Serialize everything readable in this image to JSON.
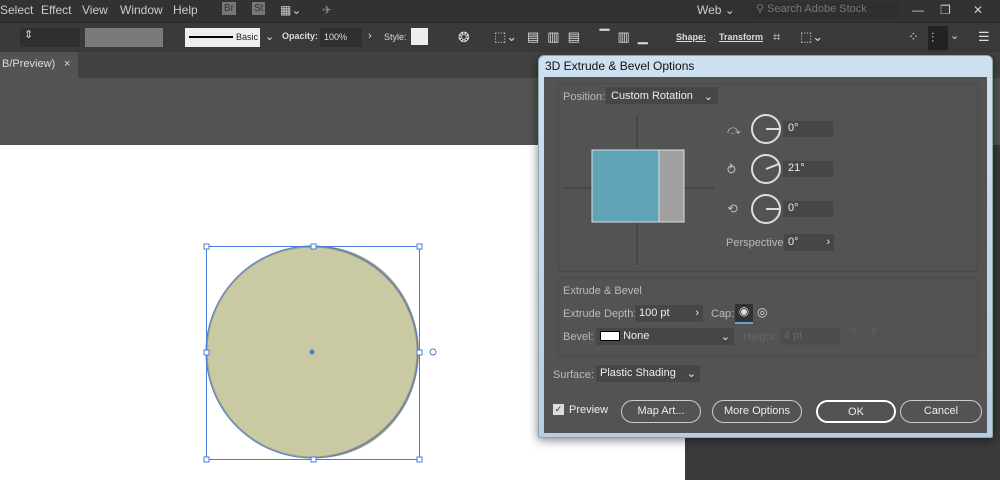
{
  "menu": [
    "Select",
    "Effect",
    "View",
    "Window",
    "Help"
  ],
  "menu_icons": [
    "Br",
    "St"
  ],
  "workspace": "Web",
  "search_placeholder": "Search Adobe Stock",
  "control": {
    "stroke_style": "Basic",
    "opacity_label": "Opacity:",
    "opacity": "100%",
    "style_label": "Style:",
    "shape": "Shape:",
    "transform": "Transform"
  },
  "doc_tab": "B/Preview)",
  "dialog": {
    "title": "3D Extrude & Bevel Options",
    "position_label": "Position:",
    "position": "Custom Rotation",
    "rot_x": "0°",
    "rot_y": "21°",
    "rot_z": "0°",
    "perspective_label": "Perspective:",
    "perspective": "0°",
    "extrude_section": "Extrude & Bevel",
    "depth_label": "Extrude Depth:",
    "depth": "100 pt",
    "cap_label": "Cap:",
    "bevel_label": "Bevel:",
    "bevel": "None",
    "height_label": "Height:",
    "height": "4 pt",
    "surface_label": "Surface:",
    "surface": "Plastic Shading",
    "preview_label": "Preview",
    "preview_checked": true,
    "map_art": "Map Art...",
    "more_options": "More Options",
    "ok": "OK",
    "cancel": "Cancel"
  },
  "colors": {
    "cube_front": "#5ea3b6",
    "cube_side": "#a0a0a0",
    "shape_fill": "#c9c9a3",
    "selection": "#4a7bd8"
  }
}
